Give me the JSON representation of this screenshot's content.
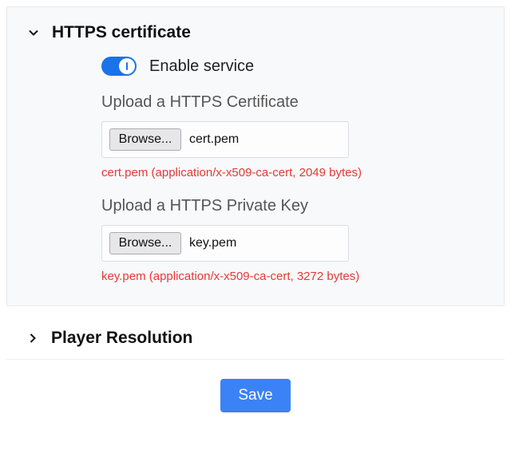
{
  "sections": {
    "https": {
      "title": "HTTPS certificate",
      "toggle_label": "Enable service",
      "cert_label": "Upload a HTTPS Certificate",
      "key_label": "Upload a HTTPS Private Key",
      "browse_label": "Browse...",
      "cert": {
        "filename": "cert.pem",
        "info": "cert.pem (application/x-x509-ca-cert, 2049 bytes)"
      },
      "key": {
        "filename": "key.pem",
        "info": "key.pem (application/x-x509-ca-cert, 3272 bytes)"
      }
    },
    "player_resolution": {
      "title": "Player Resolution"
    }
  },
  "actions": {
    "save_label": "Save"
  },
  "colors": {
    "accent": "#1a73e8",
    "error": "#e53935",
    "primary_button": "#3b82f6"
  }
}
